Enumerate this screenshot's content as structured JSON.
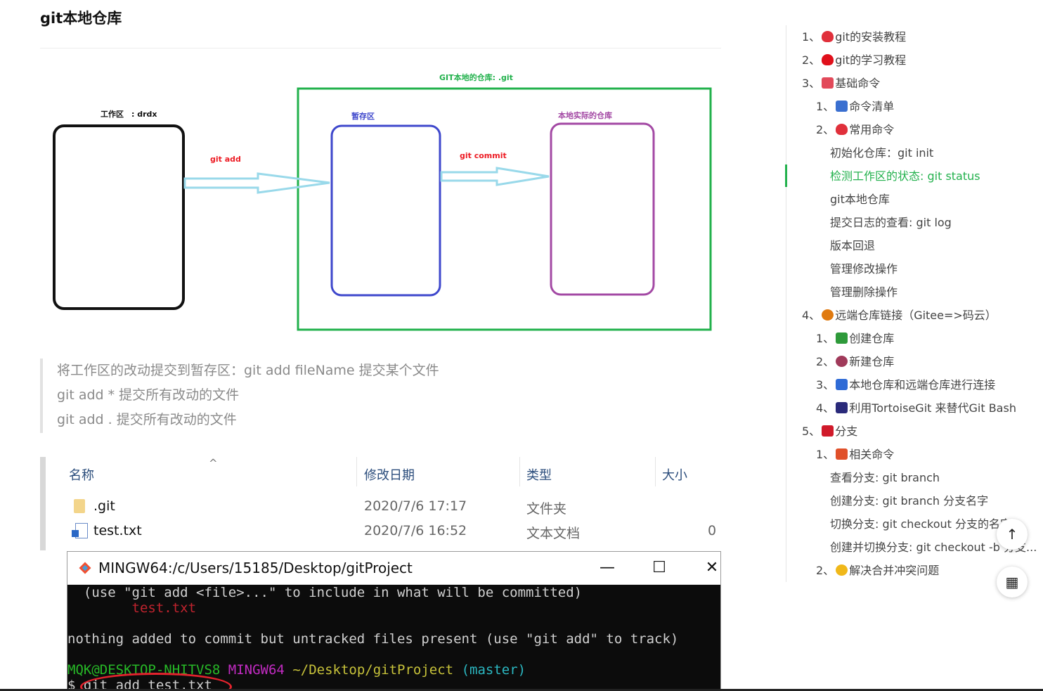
{
  "article": {
    "heading": "git本地仓库",
    "diagram": {
      "top_label": "GIT本地的仓库: .git",
      "work_label": "工作区　: drdx",
      "stage_label": "暂存区",
      "repo_label": "本地实际的仓库",
      "add_label": "git add",
      "commit_label": "git commit"
    },
    "quote_lines": [
      "将工作区的改动提交到暂存区：git add fileName 提交某个文件",
      "git add *  提交所有改动的文件",
      "git add .  提交所有改动的文件"
    ],
    "explorer": {
      "columns": [
        "名称",
        "修改日期",
        "类型",
        "大小"
      ],
      "sort_caret": "^",
      "rows": [
        {
          "name": ".git",
          "date": "2020/7/6 17:17",
          "type": "文件夹",
          "size": ""
        },
        {
          "name": "test.txt",
          "date": "2020/7/6 16:52",
          "type": "文本文档",
          "size": "0"
        }
      ]
    },
    "terminal": {
      "title": "MINGW64:/c/Users/15185/Desktop/gitProject",
      "minimize": "—",
      "maximize": "☐",
      "close": "✕",
      "line1": "  (use \"git add <file>...\" to include in what will be committed)",
      "line2": "        test.txt",
      "line3": "nothing added to commit but untracked files present (use \"git add\" to track)",
      "prompt_user": "MQK@DESKTOP-NHITVS8",
      "prompt_shell": "MINGW64",
      "prompt_path": "~/Desktop/gitProject",
      "prompt_branch": "(master)",
      "command": "$ git add test.txt"
    }
  },
  "toc": {
    "items": [
      {
        "num": "1、",
        "icon_color": "#e0303b",
        "icon": "heart-icon",
        "label": "git的安装教程",
        "indent": 0
      },
      {
        "num": "2、",
        "icon_color": "#e0101b",
        "icon": "heart-icon",
        "label": "git的学习教程",
        "indent": 0
      },
      {
        "num": "3、",
        "icon_color": "#e24a5a",
        "icon": "love-letter-icon",
        "label": "基础命令",
        "indent": 0
      },
      {
        "num": "1、",
        "icon_color": "#3a6fd0",
        "icon": "envelope-icon",
        "label": "命令清单",
        "indent": 1
      },
      {
        "num": "2、",
        "icon_color": "#e0303b",
        "icon": "heart-icon",
        "label": "常用命令",
        "indent": 1
      },
      {
        "num": "",
        "label": "初始化仓库：git init",
        "indent": 2
      },
      {
        "num": "",
        "label": "检测工作区的状态: git status",
        "indent": 2,
        "active": true
      },
      {
        "num": "",
        "label": "git本地仓库",
        "indent": 2
      },
      {
        "num": "",
        "label": "提交日志的查看: git log",
        "indent": 2
      },
      {
        "num": "",
        "label": "版本回退",
        "indent": 2
      },
      {
        "num": "",
        "label": "管理修改操作",
        "indent": 2
      },
      {
        "num": "",
        "label": "管理删除操作",
        "indent": 2
      },
      {
        "num": "4、",
        "icon_color": "#e07a10",
        "icon": "pumpkin-icon",
        "label": "远端仓库链接（Gitee=>码云）",
        "indent": 0
      },
      {
        "num": "1、",
        "icon_color": "#2e9a3a",
        "icon": "tree-icon",
        "label": "创建仓库",
        "indent": 1
      },
      {
        "num": "2、",
        "icon_color": "#a03a5a",
        "icon": "ferris-wheel-icon",
        "label": "新建仓库",
        "indent": 1
      },
      {
        "num": "3、",
        "icon_color": "#2f6bd6",
        "icon": "door-icon",
        "label": "本地仓库和远端仓库进行连接",
        "indent": 1
      },
      {
        "num": "4、",
        "icon_color": "#2a2a7a",
        "icon": "car-icon",
        "label": "利用TortoiseGit 来替代Git Bash",
        "indent": 1
      },
      {
        "num": "5、",
        "icon_color": "#d01a2a",
        "icon": "lips-icon",
        "label": "分支",
        "indent": 0
      },
      {
        "num": "1、",
        "icon_color": "#e0502a",
        "icon": "rainbow-flag-icon",
        "label": "相关命令",
        "indent": 1
      },
      {
        "num": "",
        "label": "查看分支: git branch",
        "indent": 2
      },
      {
        "num": "",
        "label": "创建分支: git branch 分支名字",
        "indent": 2
      },
      {
        "num": "",
        "label": "切换分支: git checkout 分支的名字",
        "indent": 2
      },
      {
        "num": "",
        "label": "创建并切换分支: git checkout -b 分支...",
        "indent": 2
      },
      {
        "num": "2、",
        "icon_color": "#f0b81a",
        "icon": "smiley-icon",
        "label": "解决合并冲突问题",
        "indent": 1
      }
    ]
  },
  "fab": {
    "top_icon": "↑",
    "qr_icon": "▦"
  }
}
